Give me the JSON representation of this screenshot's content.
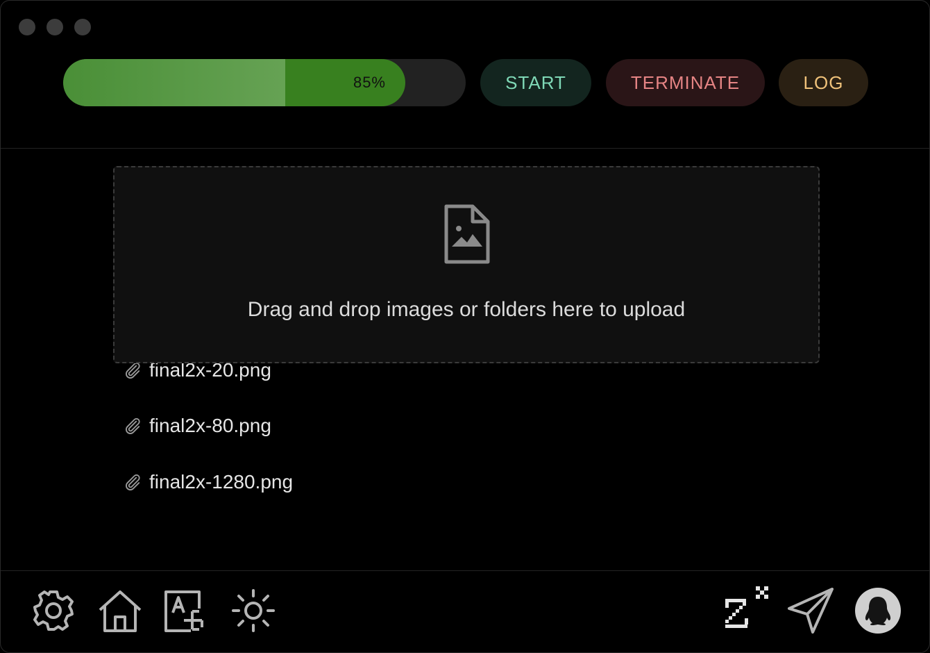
{
  "toolbar": {
    "progress": {
      "value": 0.85,
      "label": "85%"
    },
    "start_label": "START",
    "terminate_label": "TERMINATE",
    "log_label": "LOG"
  },
  "files": [
    {
      "name": "final2x-20.png"
    },
    {
      "name": "final2x-80.png"
    },
    {
      "name": "final2x-1280.png"
    }
  ],
  "dropzone": {
    "text": "Drag and drop images or folders here to upload",
    "icon": "image-file-icon"
  },
  "bottom_bar": {
    "left_icons": [
      "gear-icon",
      "home-icon",
      "font-add-icon",
      "sun-icon"
    ],
    "right_icons": [
      "z-logo-icon",
      "send-icon",
      "qq-penguin-icon"
    ]
  },
  "colors": {
    "progress_fill": "#38801f",
    "start": "#7fd8b6",
    "terminate": "#e58484",
    "log": "#f0c27a"
  }
}
